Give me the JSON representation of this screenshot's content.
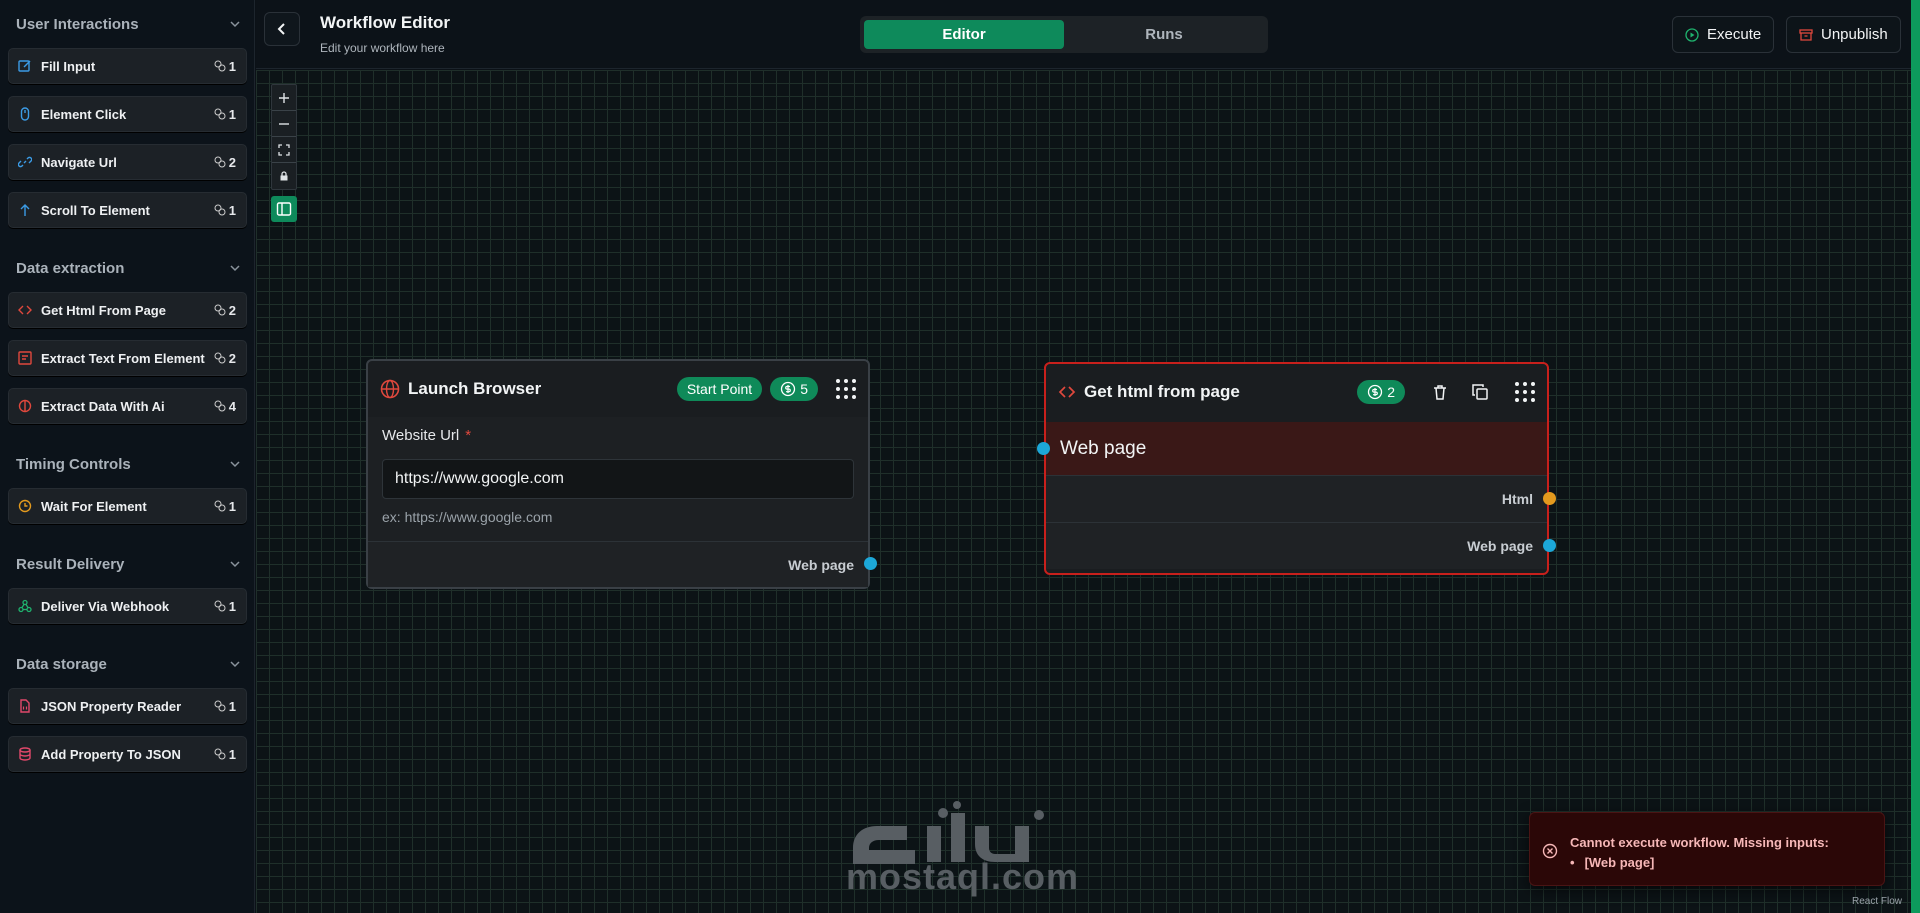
{
  "sidebar": {
    "sections": [
      {
        "title": "User Interactions",
        "items": [
          {
            "label": "Fill Input",
            "count": "1",
            "icon": "edit-icon",
            "color": "#3b9be5"
          },
          {
            "label": "Element Click",
            "count": "1",
            "icon": "mouse-icon",
            "color": "#3b9be5"
          },
          {
            "label": "Navigate Url",
            "count": "2",
            "icon": "link-icon",
            "color": "#3b9be5"
          },
          {
            "label": "Scroll To Element",
            "count": "1",
            "icon": "arrow-up-icon",
            "color": "#3b9be5"
          }
        ]
      },
      {
        "title": "Data extraction",
        "items": [
          {
            "label": "Get Html From Page",
            "count": "2",
            "icon": "code-icon",
            "color": "#e0483d"
          },
          {
            "label": "Extract Text From Element",
            "count": "2",
            "icon": "text-icon",
            "color": "#e0483d"
          },
          {
            "label": "Extract Data With Ai",
            "count": "4",
            "icon": "brain-icon",
            "color": "#e0483d"
          }
        ]
      },
      {
        "title": "Timing Controls",
        "items": [
          {
            "label": "Wait For Element",
            "count": "1",
            "icon": "clock-icon",
            "color": "#e39a1e"
          }
        ]
      },
      {
        "title": "Result Delivery",
        "items": [
          {
            "label": "Deliver Via Webhook",
            "count": "1",
            "icon": "webhook-icon",
            "color": "#1fb36e"
          }
        ]
      },
      {
        "title": "Data storage",
        "items": [
          {
            "label": "JSON Property Reader",
            "count": "1",
            "icon": "file-json-icon",
            "color": "#e0486a"
          },
          {
            "label": "Add Property To JSON",
            "count": "1",
            "icon": "database-icon",
            "color": "#e0486a"
          }
        ]
      }
    ]
  },
  "header": {
    "title": "Workflow Editor",
    "subtitle": "Edit your workflow here",
    "tabs": [
      "Editor",
      "Runs"
    ],
    "execute_label": "Execute",
    "unpublish_label": "Unpublish"
  },
  "nodes": {
    "launch": {
      "title": "Launch Browser",
      "badge": "Start Point",
      "credits": "5",
      "field_label": "Website Url",
      "required_mark": "*",
      "input_value": "https://www.google.com",
      "hint": "ex: https://www.google.com",
      "output": "Web page"
    },
    "gethtml": {
      "title": "Get html from page",
      "credits": "2",
      "input": "Web page",
      "outputs": [
        "Html",
        "Web page"
      ]
    }
  },
  "toast": {
    "message": "Cannot execute workflow. Missing inputs:",
    "item": "[Web page]"
  },
  "attribution": "React Flow",
  "watermark": "mostaql.com",
  "colors": {
    "accent": "#0e8a5b",
    "error": "#e0483d",
    "port_blue": "#1ca7d8",
    "port_orange": "#e39a1e"
  }
}
